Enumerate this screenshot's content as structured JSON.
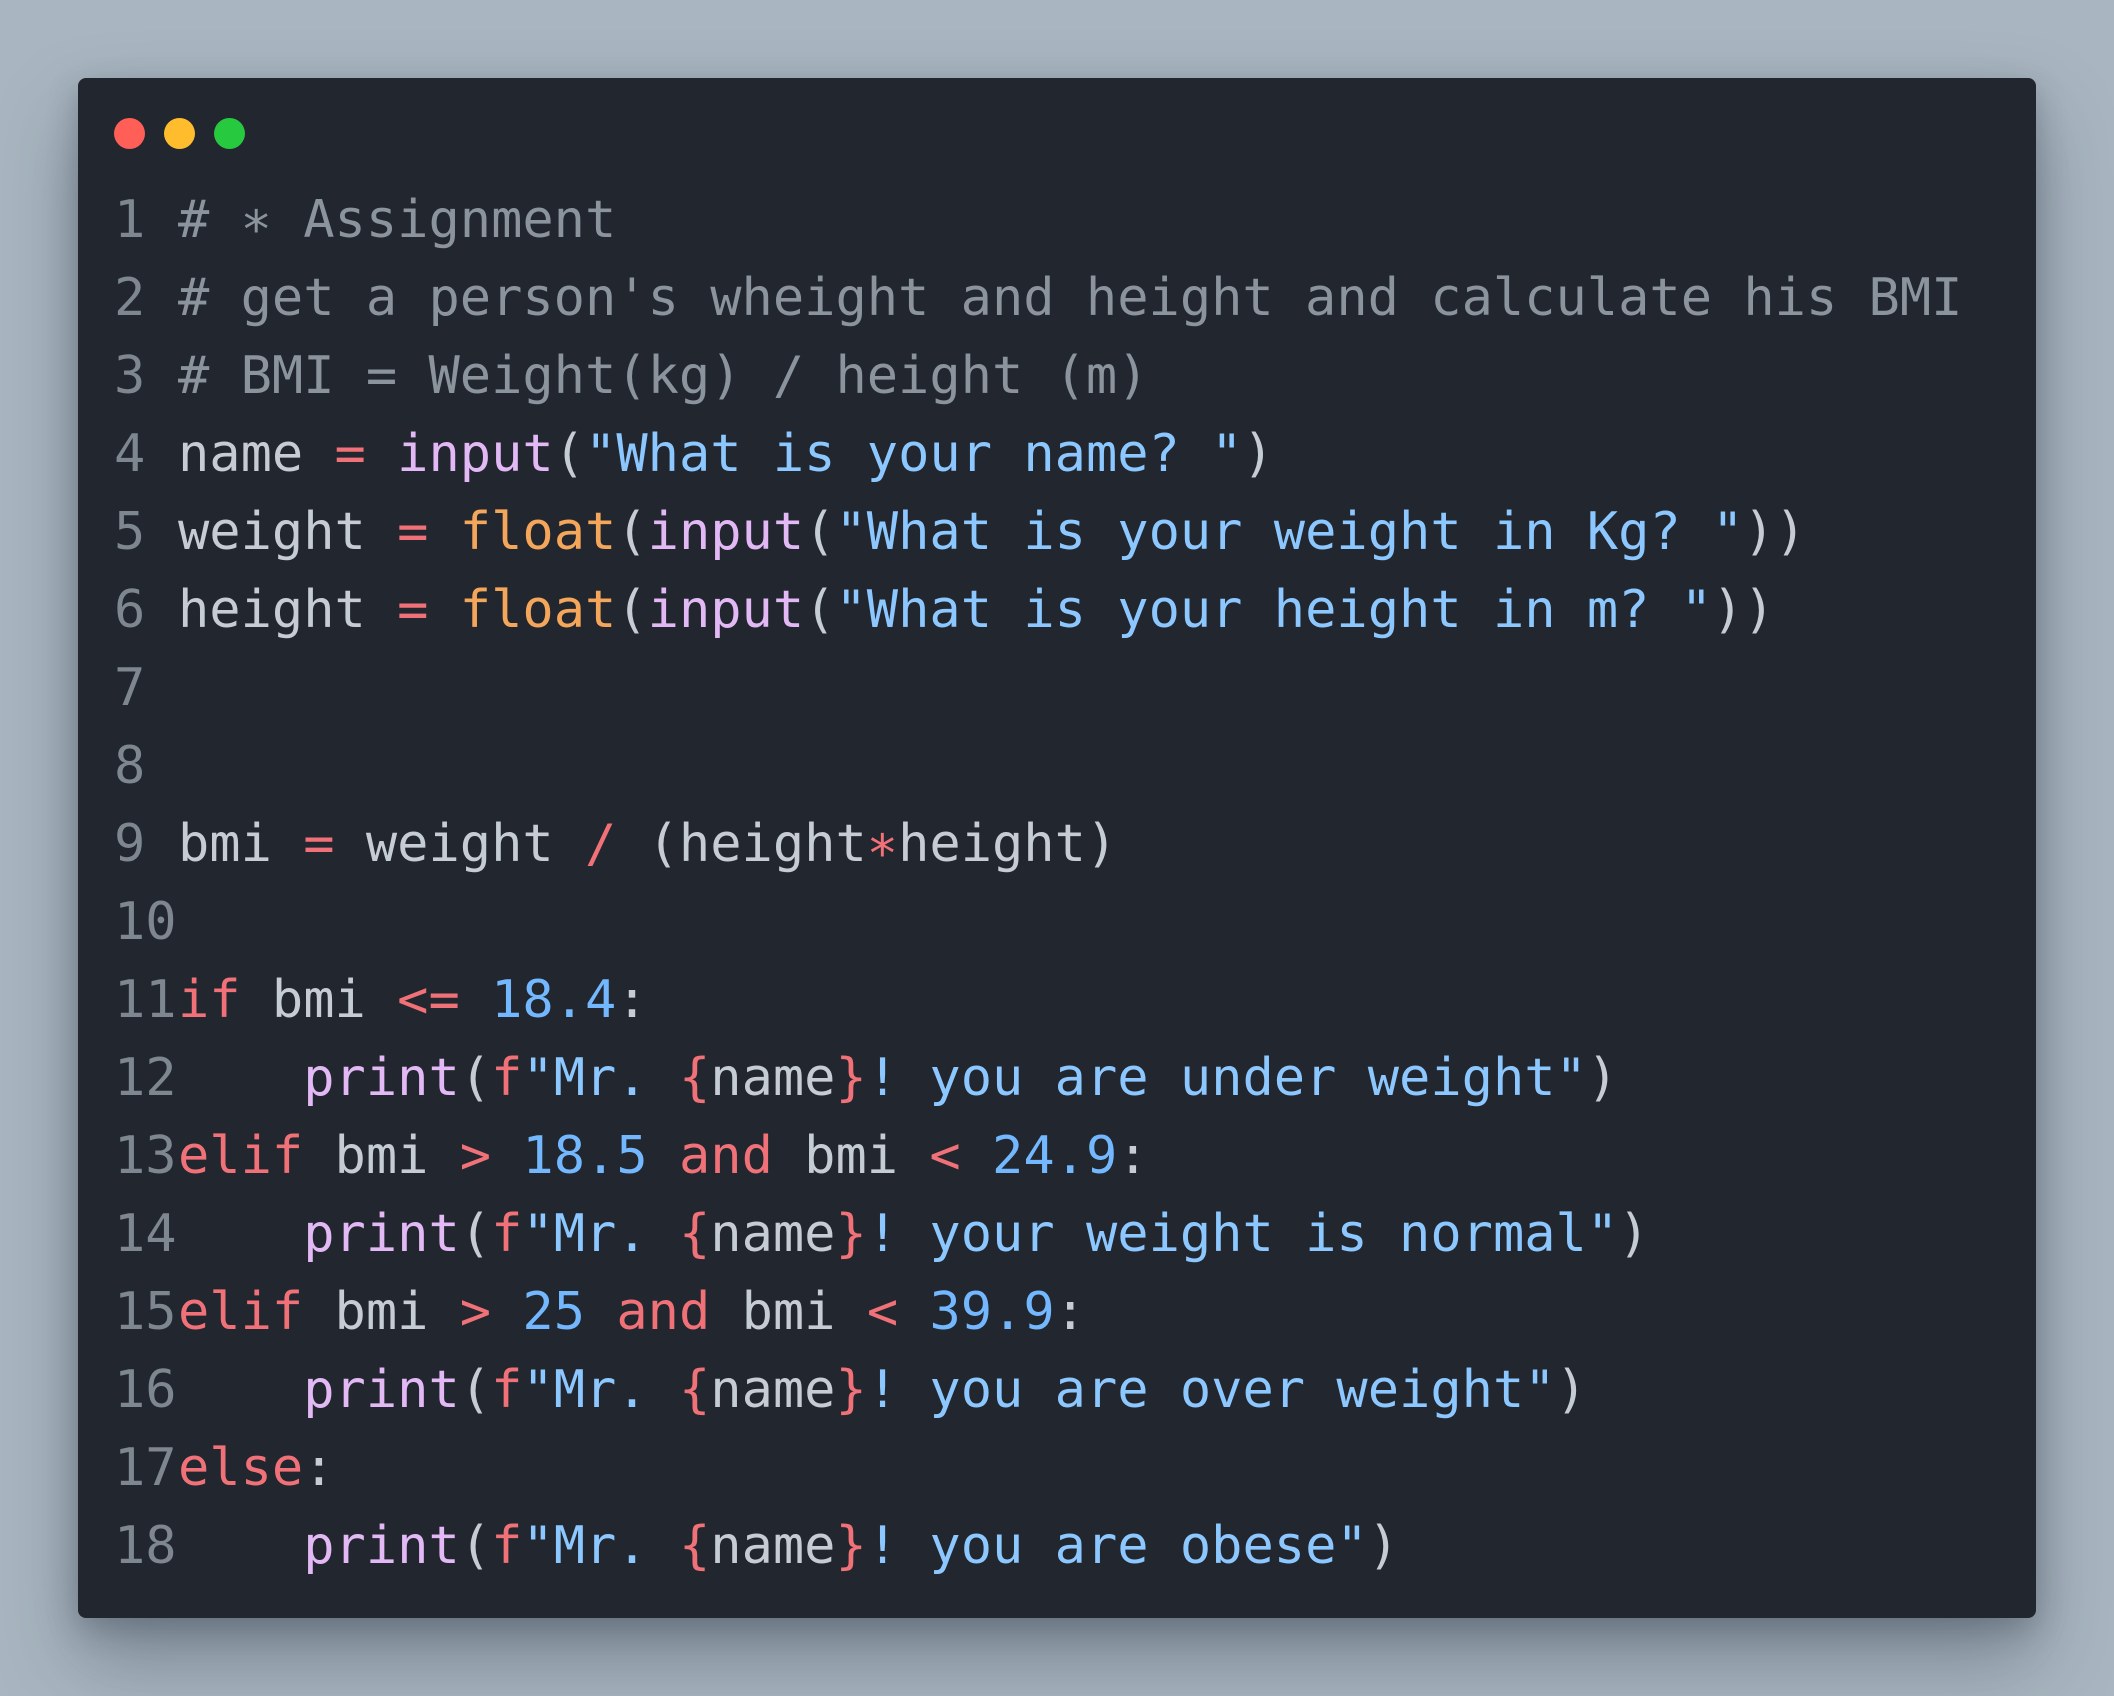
{
  "window": {
    "controls": [
      "close",
      "minimize",
      "maximize"
    ]
  },
  "code": {
    "language": "python",
    "lines": [
      {
        "n": "1",
        "tokens": [
          {
            "t": "# ∗ Assignment",
            "k": "comment"
          }
        ]
      },
      {
        "n": "2",
        "tokens": [
          {
            "t": "# get a person's wheight and height and calculate his BMI",
            "k": "comment"
          }
        ]
      },
      {
        "n": "3",
        "tokens": [
          {
            "t": "# BMI = Weight(kg) / height (m)",
            "k": "comment"
          }
        ]
      },
      {
        "n": "4",
        "tokens": [
          {
            "t": "name ",
            "k": "text"
          },
          {
            "t": "=",
            "k": "op"
          },
          {
            "t": " ",
            "k": "text"
          },
          {
            "t": "input",
            "k": "func"
          },
          {
            "t": "(",
            "k": "punct"
          },
          {
            "t": "\"What is your name? \"",
            "k": "string"
          },
          {
            "t": ")",
            "k": "punct"
          }
        ]
      },
      {
        "n": "5",
        "tokens": [
          {
            "t": "weight ",
            "k": "text"
          },
          {
            "t": "=",
            "k": "op"
          },
          {
            "t": " ",
            "k": "text"
          },
          {
            "t": "float",
            "k": "builtin"
          },
          {
            "t": "(",
            "k": "punct"
          },
          {
            "t": "input",
            "k": "func"
          },
          {
            "t": "(",
            "k": "punct"
          },
          {
            "t": "\"What is your weight in Kg? \"",
            "k": "string"
          },
          {
            "t": "))",
            "k": "punct"
          }
        ]
      },
      {
        "n": "6",
        "tokens": [
          {
            "t": "height ",
            "k": "text"
          },
          {
            "t": "=",
            "k": "op"
          },
          {
            "t": " ",
            "k": "text"
          },
          {
            "t": "float",
            "k": "builtin"
          },
          {
            "t": "(",
            "k": "punct"
          },
          {
            "t": "input",
            "k": "func"
          },
          {
            "t": "(",
            "k": "punct"
          },
          {
            "t": "\"What is your height in m? \"",
            "k": "string"
          },
          {
            "t": "))",
            "k": "punct"
          }
        ]
      },
      {
        "n": "7",
        "tokens": []
      },
      {
        "n": "8",
        "tokens": []
      },
      {
        "n": "9",
        "tokens": [
          {
            "t": "bmi ",
            "k": "text"
          },
          {
            "t": "=",
            "k": "op"
          },
          {
            "t": " weight ",
            "k": "text"
          },
          {
            "t": "/",
            "k": "op"
          },
          {
            "t": " (height",
            "k": "text"
          },
          {
            "t": "∗",
            "k": "op"
          },
          {
            "t": "height)",
            "k": "text"
          }
        ]
      },
      {
        "n": "10",
        "tokens": []
      },
      {
        "n": "11",
        "tokens": [
          {
            "t": "if",
            "k": "keyword"
          },
          {
            "t": " bmi ",
            "k": "text"
          },
          {
            "t": "<=",
            "k": "op"
          },
          {
            "t": " ",
            "k": "text"
          },
          {
            "t": "18.4",
            "k": "number"
          },
          {
            "t": ":",
            "k": "punct"
          }
        ]
      },
      {
        "n": "12",
        "tokens": [
          {
            "t": "    ",
            "k": "text"
          },
          {
            "t": "print",
            "k": "func"
          },
          {
            "t": "(",
            "k": "punct"
          },
          {
            "t": "f",
            "k": "keyword"
          },
          {
            "t": "\"Mr. ",
            "k": "string"
          },
          {
            "t": "{",
            "k": "brace"
          },
          {
            "t": "name",
            "k": "text"
          },
          {
            "t": "}",
            "k": "brace"
          },
          {
            "t": "! you are under weight\"",
            "k": "string"
          },
          {
            "t": ")",
            "k": "punct"
          }
        ]
      },
      {
        "n": "13",
        "tokens": [
          {
            "t": "elif",
            "k": "keyword"
          },
          {
            "t": " bmi ",
            "k": "text"
          },
          {
            "t": ">",
            "k": "op"
          },
          {
            "t": " ",
            "k": "text"
          },
          {
            "t": "18.5",
            "k": "number"
          },
          {
            "t": " ",
            "k": "text"
          },
          {
            "t": "and",
            "k": "keyword"
          },
          {
            "t": " bmi ",
            "k": "text"
          },
          {
            "t": "<",
            "k": "op"
          },
          {
            "t": " ",
            "k": "text"
          },
          {
            "t": "24.9",
            "k": "number"
          },
          {
            "t": ":",
            "k": "punct"
          }
        ]
      },
      {
        "n": "14",
        "tokens": [
          {
            "t": "    ",
            "k": "text"
          },
          {
            "t": "print",
            "k": "func"
          },
          {
            "t": "(",
            "k": "punct"
          },
          {
            "t": "f",
            "k": "keyword"
          },
          {
            "t": "\"Mr. ",
            "k": "string"
          },
          {
            "t": "{",
            "k": "brace"
          },
          {
            "t": "name",
            "k": "text"
          },
          {
            "t": "}",
            "k": "brace"
          },
          {
            "t": "! your weight is normal\"",
            "k": "string"
          },
          {
            "t": ")",
            "k": "punct"
          }
        ]
      },
      {
        "n": "15",
        "tokens": [
          {
            "t": "elif",
            "k": "keyword"
          },
          {
            "t": " bmi ",
            "k": "text"
          },
          {
            "t": ">",
            "k": "op"
          },
          {
            "t": " ",
            "k": "text"
          },
          {
            "t": "25",
            "k": "number"
          },
          {
            "t": " ",
            "k": "text"
          },
          {
            "t": "and",
            "k": "keyword"
          },
          {
            "t": " bmi ",
            "k": "text"
          },
          {
            "t": "<",
            "k": "op"
          },
          {
            "t": " ",
            "k": "text"
          },
          {
            "t": "39.9",
            "k": "number"
          },
          {
            "t": ":",
            "k": "punct"
          }
        ]
      },
      {
        "n": "16",
        "tokens": [
          {
            "t": "    ",
            "k": "text"
          },
          {
            "t": "print",
            "k": "func"
          },
          {
            "t": "(",
            "k": "punct"
          },
          {
            "t": "f",
            "k": "keyword"
          },
          {
            "t": "\"Mr. ",
            "k": "string"
          },
          {
            "t": "{",
            "k": "brace"
          },
          {
            "t": "name",
            "k": "text"
          },
          {
            "t": "}",
            "k": "brace"
          },
          {
            "t": "! you are over weight\"",
            "k": "string"
          },
          {
            "t": ")",
            "k": "punct"
          }
        ]
      },
      {
        "n": "17",
        "tokens": [
          {
            "t": "else",
            "k": "keyword"
          },
          {
            "t": ":",
            "k": "punct"
          }
        ]
      },
      {
        "n": "18",
        "tokens": [
          {
            "t": "    ",
            "k": "text"
          },
          {
            "t": "print",
            "k": "func"
          },
          {
            "t": "(",
            "k": "punct"
          },
          {
            "t": "f",
            "k": "keyword"
          },
          {
            "t": "\"Mr. ",
            "k": "string"
          },
          {
            "t": "{",
            "k": "brace"
          },
          {
            "t": "name",
            "k": "text"
          },
          {
            "t": "}",
            "k": "brace"
          },
          {
            "t": "! you are obese\"",
            "k": "string"
          },
          {
            "t": ")",
            "k": "punct"
          }
        ]
      }
    ]
  },
  "colors": {
    "page_background": "#a9b6c1",
    "editor_background": "#22262e",
    "close_dot": "#ff5f56",
    "minimize_dot": "#ffbd2e",
    "maximize_dot": "#27c93f"
  }
}
